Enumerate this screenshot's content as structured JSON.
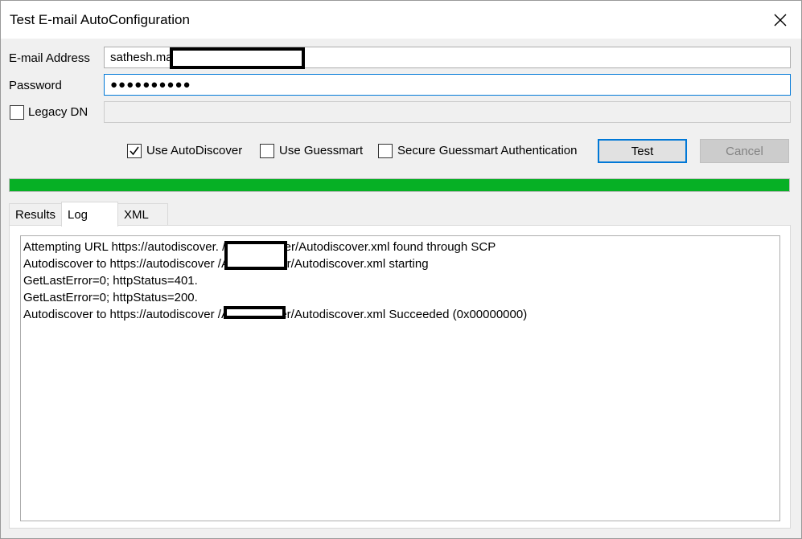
{
  "window": {
    "title": "Test E-mail AutoConfiguration"
  },
  "form": {
    "email_label": "E-mail Address",
    "email_value": "sathesh.ma",
    "password_label": "Password",
    "password_value": "●●●●●●●●●●",
    "legacy_dn_label": "Legacy DN",
    "legacy_dn_checked": false,
    "legacy_dn_value": ""
  },
  "options": {
    "use_autodiscover_label": "Use AutoDiscover",
    "use_autodiscover_checked": true,
    "use_guessmart_label": "Use Guessmart",
    "use_guessmart_checked": false,
    "secure_guessmart_label": "Secure Guessmart Authentication",
    "secure_guessmart_checked": false
  },
  "buttons": {
    "test_label": "Test",
    "cancel_label": "Cancel"
  },
  "progress": {
    "value": 1.0,
    "color": "#06b025"
  },
  "tabs": [
    {
      "label": "Results",
      "active": false
    },
    {
      "label": "Log",
      "active": true
    },
    {
      "label": "XML",
      "active": false
    }
  ],
  "log": {
    "lines": [
      "Attempting URL https://autodiscover.                /Autodiscover/Autodiscover.xml found through SCP",
      "Autodiscover to https://autodiscover                /Autodiscover/Autodiscover.xml starting",
      "GetLastError=0; httpStatus=401.",
      "GetLastError=0; httpStatus=200.",
      "Autodiscover to https://autodiscover                /Autodiscover/Autodiscover.xml Succeeded (0x00000000)"
    ]
  },
  "icons": {
    "close": "close-icon",
    "checkmark": "checkmark-icon"
  }
}
